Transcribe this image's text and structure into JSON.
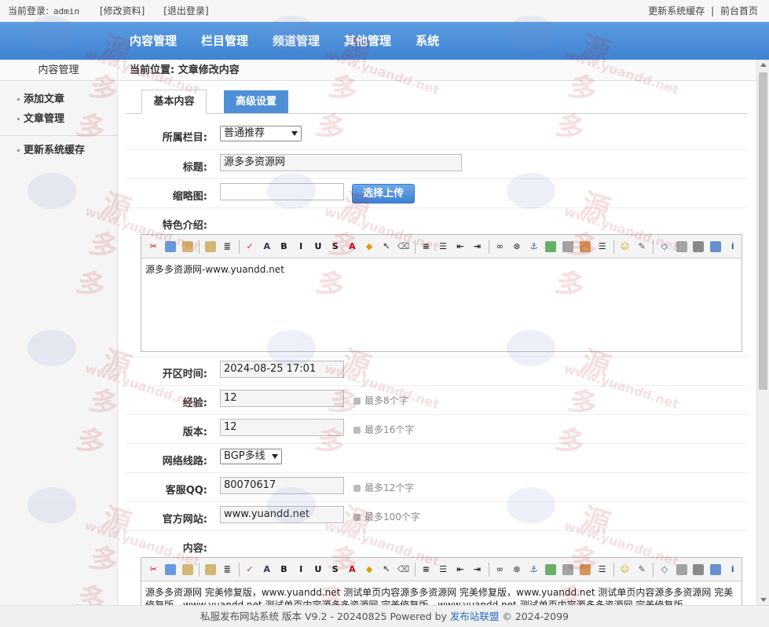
{
  "topbar": {
    "login_label": "当前登录:",
    "username": "admin",
    "edit_profile": "[修改资料]",
    "logout": "[退出登录]",
    "refresh_cache": "更新系统缓存",
    "divider": "|",
    "frontend_home": "前台首页"
  },
  "nav": {
    "items": [
      "内容管理",
      "栏目管理",
      "频道管理",
      "其他管理",
      "系统"
    ]
  },
  "sidebar": {
    "title": "内容管理",
    "items": [
      "添加文章",
      "文章管理"
    ],
    "extra_item": "更新系统缓存"
  },
  "breadcrumb": {
    "text": "当前位置: 文章修改内容"
  },
  "tabs": {
    "basic": "基本内容",
    "advanced": "高级设置"
  },
  "form": {
    "category_label": "所属栏目:",
    "category_value": "普通推荐",
    "title_label": "标题:",
    "title_value": "源多多资源网",
    "thumb_label": "缩略图:",
    "thumb_value": "",
    "upload_button": "选择上传",
    "intro_label": "特色介绍:",
    "intro_text": "源多多资源网-www.yuandd.net",
    "open_time_label": "开区时间:",
    "open_time_value": "2024-08-25 17:01",
    "exp_label": "经验:",
    "exp_value": "12",
    "exp_hint": "最多8个字",
    "version_label": "版本:",
    "version_value": "12",
    "version_hint": "最多16个字",
    "network_label": "网络线路:",
    "network_value": "BGP多线",
    "qq_label": "客服QQ:",
    "qq_value": "80070617",
    "qq_hint": "最多12个字",
    "website_label": "官方网站:",
    "website_value": "www.yuandd.net",
    "website_hint": "最多100个字",
    "content_label": "内容:",
    "content_text": "源多多资源网 完美修复版，www.yuandd.net 测试单页内容源多多资源网 完美修复版，www.yuandd.net 测试单页内容源多多资源网 完美修复版，www.yuandd.net 测试单页内容源多多资源网 完美修复版，www.yuandd.net 测试单页内容源多多资源网 完美修复版，www.yuandd.net 测试单页内容源多多资源网 完美修复版，www.yuandd.net 测"
  },
  "toolbar_icons": [
    "cut-icon",
    "copy-icon",
    "paste-icon",
    "paste-text-icon",
    "format-icon",
    "spellcheck-icon",
    "font-icon",
    "bold-icon",
    "italic-icon",
    "underline-icon",
    "strikethrough-icon",
    "font-color-icon",
    "bg-color-icon",
    "select-icon",
    "eraser-icon",
    "align-icon",
    "list-icon",
    "outdent-icon",
    "indent-icon",
    "link-icon",
    "unlink-icon",
    "anchor-icon",
    "image-upload-icon",
    "flash-icon",
    "media-icon",
    "hr-icon",
    "emoticon-icon",
    "edit-icon",
    "source-icon",
    "preview-icon",
    "print-icon",
    "fullscreen-icon",
    "about-icon"
  ],
  "watermark": {
    "brand": "源多多",
    "url": "www.yuandd.net"
  },
  "footer": {
    "text_prefix": "私服发布网站系统 版本 V9.2 - 20240825 Powered by ",
    "link": "发布站联盟",
    "text_suffix": " © 2024-2099"
  },
  "colors": {
    "nav_bg": "#4a8edb",
    "tab_active_text": "#333333",
    "tab_inactive_bg": "#4f8fd8",
    "link": "#2a6cc0"
  }
}
